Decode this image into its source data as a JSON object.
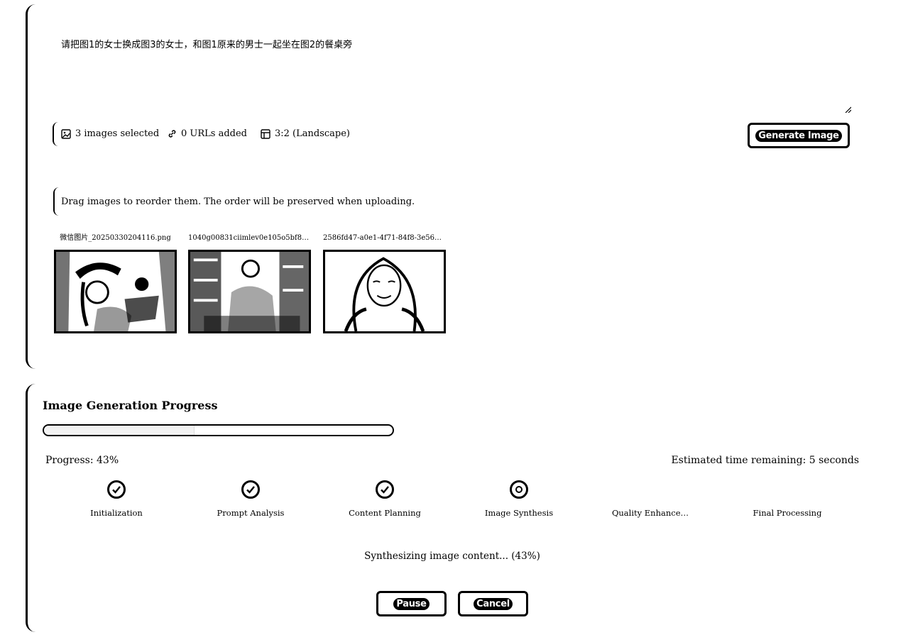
{
  "prompt": {
    "value": "请把图1的女士换成图3的女士，和图1原来的男士一起坐在图2的餐桌旁"
  },
  "options": {
    "images_selected": "3 images selected",
    "urls_added": "0 URLs added",
    "aspect_ratio": "3:2 (Landscape)"
  },
  "generate_button": {
    "label": "Generate Image"
  },
  "reorder_hint": "Drag images to reorder them. The order will be preserved when uploading.",
  "images": [
    {
      "name": "微信图片_20250330204116.png"
    },
    {
      "name": "1040g00831ciimlev0e105o5bf8e…"
    },
    {
      "name": "2586fd47-a0e1-4f71-84f8-3e569…"
    }
  ],
  "progress": {
    "title": "Image Generation Progress",
    "percent": 43,
    "progress_label": "Progress: 43%",
    "eta_label": "Estimated time remaining: 5 seconds",
    "steps": [
      {
        "label": "Initialization",
        "state": "done"
      },
      {
        "label": "Prompt Analysis",
        "state": "done"
      },
      {
        "label": "Content Planning",
        "state": "done"
      },
      {
        "label": "Image Synthesis",
        "state": "active"
      },
      {
        "label": "Quality Enhance…",
        "state": "pending"
      },
      {
        "label": "Final Processing",
        "state": "pending"
      }
    ],
    "status": "Synthesizing image content... (43%)"
  },
  "controls": {
    "pause_label": "Pause",
    "cancel_label": "Cancel"
  },
  "icons": {
    "images": "image-icon",
    "urls": "link-icon",
    "aspect": "layout-icon",
    "step_done": "check-circle-icon",
    "step_active": "radio-dot-icon"
  }
}
